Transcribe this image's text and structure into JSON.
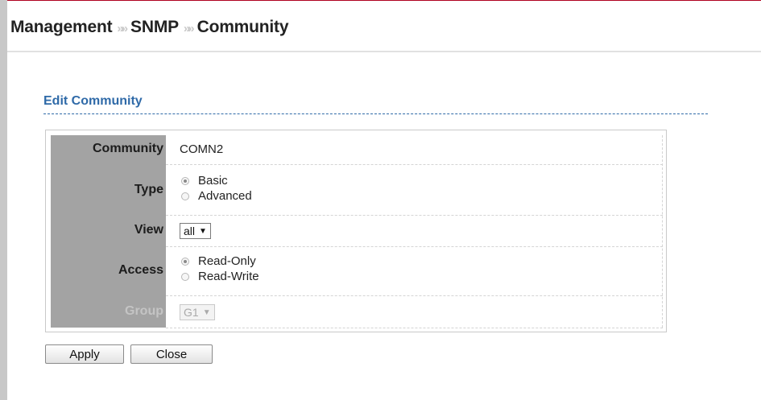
{
  "breadcrumb": {
    "items": [
      "Management",
      "SNMP",
      "Community"
    ],
    "separator": "»»"
  },
  "section": {
    "title": "Edit Community"
  },
  "form": {
    "community": {
      "label": "Community",
      "value": "COMN2"
    },
    "type": {
      "label": "Type",
      "options": [
        {
          "label": "Basic",
          "selected": true
        },
        {
          "label": "Advanced",
          "selected": false
        }
      ]
    },
    "view": {
      "label": "View",
      "selected": "all"
    },
    "access": {
      "label": "Access",
      "options": [
        {
          "label": "Read-Only",
          "selected": true
        },
        {
          "label": "Read-Write",
          "selected": false
        }
      ]
    },
    "group": {
      "label": "Group",
      "selected": "G1",
      "disabled": true
    }
  },
  "buttons": {
    "apply": "Apply",
    "close": "Close"
  },
  "colors": {
    "accent": "#2f6aa8",
    "label_column": "#a3a3a3"
  }
}
